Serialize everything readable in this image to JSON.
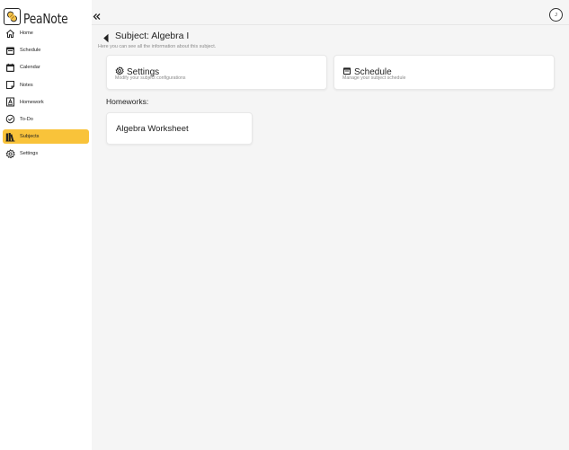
{
  "app": {
    "name": "PeaNote"
  },
  "sidebar": {
    "items": [
      {
        "label": "Home",
        "icon": "home-icon",
        "active": false
      },
      {
        "label": "Schedule",
        "icon": "schedule-icon",
        "active": false
      },
      {
        "label": "Calendar",
        "icon": "calendar-icon",
        "active": false
      },
      {
        "label": "Notes",
        "icon": "notes-icon",
        "active": false
      },
      {
        "label": "Homework",
        "icon": "homework-icon",
        "active": false
      },
      {
        "label": "To-Do",
        "icon": "todo-check-icon",
        "active": false
      },
      {
        "label": "Subjects",
        "icon": "subjects-icon",
        "active": true
      },
      {
        "label": "Settings",
        "icon": "gear-icon",
        "active": false
      }
    ]
  },
  "header": {
    "avatar_initial": "J"
  },
  "page": {
    "title": "Subject: Algebra I",
    "subtitle": "Here you can see all the information about this subject."
  },
  "cards": {
    "settings": {
      "title": "Settings",
      "description": "Modify your subject configurations",
      "icon": "gear-icon"
    },
    "schedule": {
      "title": "Schedule",
      "description": "Manage your subject schedule",
      "icon": "calendar-icon"
    }
  },
  "homeworks": {
    "section_title": "Homeworks:",
    "items": [
      {
        "title": "Algebra Worksheet"
      }
    ]
  },
  "colors": {
    "accent": "#f9c33a",
    "main_background": "#f5f5f5",
    "card_background": "#ffffff"
  }
}
